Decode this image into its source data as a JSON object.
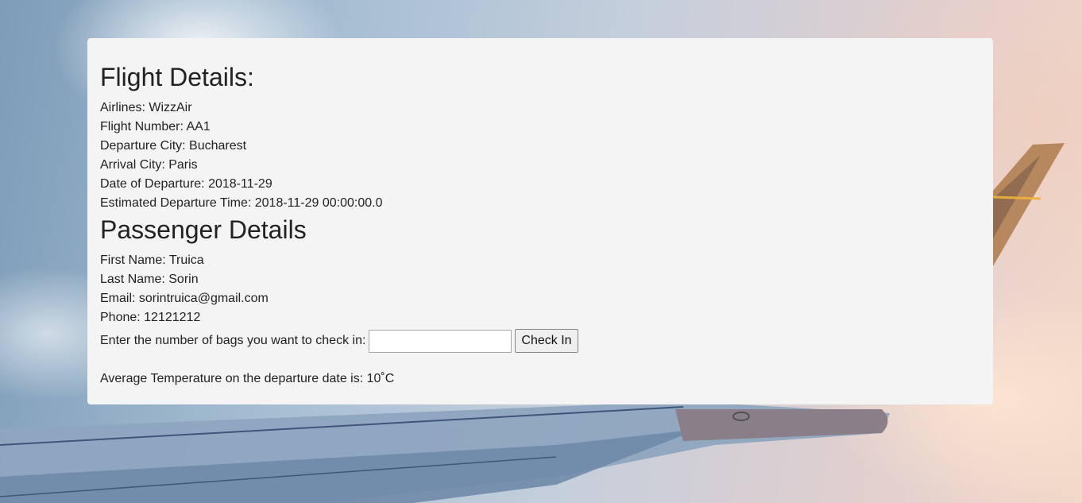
{
  "flight": {
    "heading": "Flight Details:",
    "airlines": "Airlines: WizzAir",
    "flight_number": "Flight Number: AA1",
    "departure_city": "Departure City: Bucharest",
    "arrival_city": "Arrival City: Paris",
    "date_of_departure": "Date of Departure: 2018-11-29",
    "estimated_departure_time": "Estimated Departure Time: 2018-11-29 00:00:00.0"
  },
  "passenger": {
    "heading": "Passenger Details",
    "first_name": "First Name: Truica",
    "last_name": "Last Name: Sorin",
    "email": "Email: sorintruica@gmail.com",
    "phone": "Phone: 12121212"
  },
  "checkin": {
    "label": "Enter the number of bags you want to check in:",
    "input_value": "",
    "button_label": "Check In"
  },
  "temperature": {
    "text": "Average Temperature on the departure date is: 10˚C"
  }
}
